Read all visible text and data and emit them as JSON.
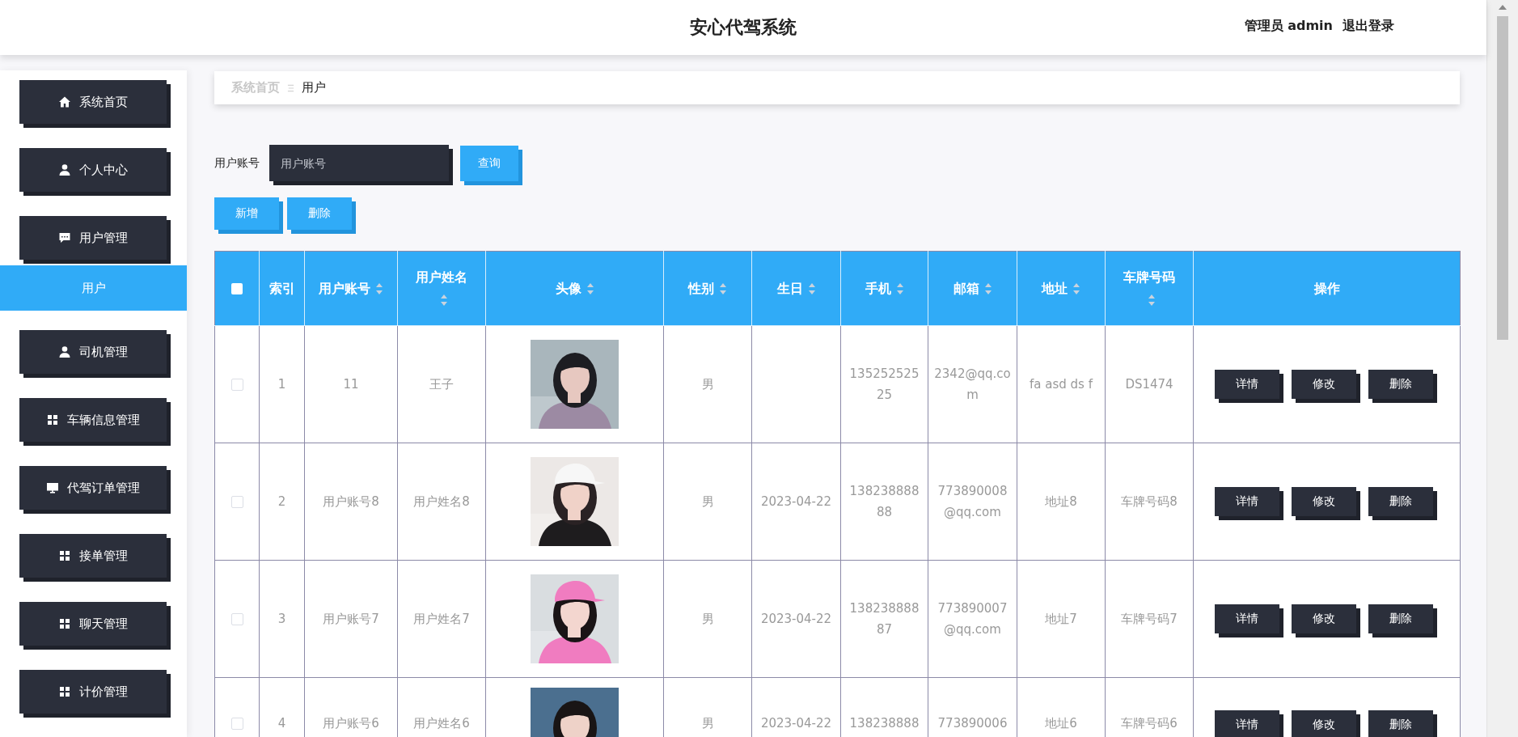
{
  "header": {
    "title": "安心代驾系统",
    "user_role": "管理员 admin",
    "logout": "退出登录"
  },
  "sidebar": {
    "items": [
      {
        "label": "系统首页"
      },
      {
        "label": "个人中心"
      },
      {
        "label": "用户管理",
        "children": [
          {
            "label": "用户",
            "selected": true
          }
        ]
      },
      {
        "label": "司机管理"
      },
      {
        "label": "车辆信息管理"
      },
      {
        "label": "代驾订单管理"
      },
      {
        "label": "接单管理"
      },
      {
        "label": "聊天管理"
      },
      {
        "label": "计价管理"
      }
    ]
  },
  "breadcrumb": [
    "系统首页",
    "用户"
  ],
  "search": {
    "label": "用户账号",
    "placeholder": "用户账号",
    "button": "查询"
  },
  "actions": [
    "新增",
    "删除"
  ],
  "table": {
    "select_all_checked": false,
    "columns": [
      {
        "label": "索引",
        "sortable": false
      },
      {
        "label": "用户账号",
        "sortable": true
      },
      {
        "label": "用户姓名",
        "sortable": true
      },
      {
        "label": "头像",
        "sortable": true
      },
      {
        "label": "性别",
        "sortable": true
      },
      {
        "label": "生日",
        "sortable": true
      },
      {
        "label": "手机",
        "sortable": true
      },
      {
        "label": "邮箱",
        "sortable": true
      },
      {
        "label": "地址",
        "sortable": true
      },
      {
        "label": "车牌号码",
        "sortable": true
      },
      {
        "label": "操作",
        "sortable": false
      }
    ],
    "rows": [
      {
        "checked": false,
        "cells": [
          "1",
          "11",
          "王子",
          {
            "kind": "picture"
          },
          "男",
          "",
          "13525252525",
          "2342@qq.com",
          "fa asd ds f",
          "DS1474"
        ],
        "buttons": [
          "详情",
          "修改",
          "删除"
        ]
      },
      {
        "checked": false,
        "cells": [
          "2",
          "用户账号8",
          "用户姓名8",
          {
            "kind": "picture"
          },
          "男",
          "2023-04-22",
          "13823888888",
          "773890008@qq.com",
          "地址8",
          "车牌号码8"
        ],
        "buttons": [
          "详情",
          "修改",
          "删除"
        ]
      },
      {
        "checked": false,
        "cells": [
          "3",
          "用户账号7",
          "用户姓名7",
          {
            "kind": "picture"
          },
          "男",
          "2023-04-22",
          "13823888887",
          "773890007@qq.com",
          "地址7",
          "车牌号码7"
        ],
        "buttons": [
          "详情",
          "修改",
          "删除"
        ]
      },
      {
        "checked": false,
        "cells": [
          "4",
          "用户账号6",
          "用户姓名6",
          {
            "kind": "picture"
          },
          "男",
          "2023-04-22",
          "138238888",
          "773890006",
          "地址6",
          "车牌号码6"
        ],
        "buttons": [
          "详情",
          "修改",
          "删除"
        ]
      }
    ]
  }
}
